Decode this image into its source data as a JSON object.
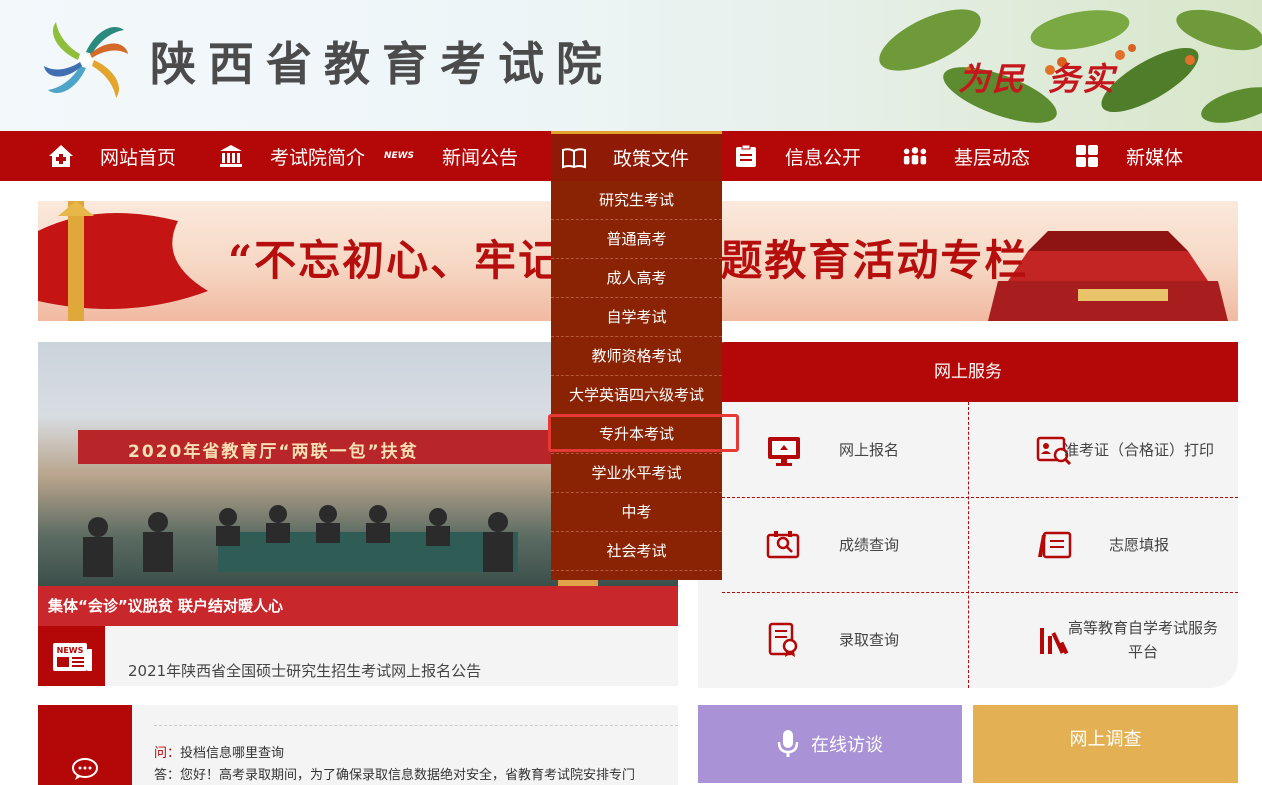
{
  "header": {
    "site_title": "陕西省教育考试院",
    "slogan_1": "为民",
    "slogan_2": "务实"
  },
  "nav": {
    "items": [
      {
        "label": "网站首页",
        "icon": "home-icon"
      },
      {
        "label": "考试院简介",
        "icon": "building-icon"
      },
      {
        "label": "新闻公告",
        "icon": "news-icon",
        "icon_text": "NEWS"
      },
      {
        "label": "政策文件",
        "icon": "book-icon",
        "active": true
      },
      {
        "label": "信息公开",
        "icon": "clipboard-icon"
      },
      {
        "label": "基层动态",
        "icon": "people-icon"
      },
      {
        "label": "新媒体",
        "icon": "grid-icon"
      }
    ]
  },
  "dropdown": {
    "items": [
      "研究生考试",
      "普通高考",
      "成人高考",
      "自学考试",
      "教师资格考试",
      "大学英语四六级考试",
      "专升本考试",
      "学业水平考试",
      "中考",
      "社会考试"
    ],
    "highlighted": "专升本考试"
  },
  "banner": {
    "text": "“不忘初心、牢记使命”主题教育活动专栏"
  },
  "featured": {
    "photo_banner_text": "2020年省教育厅“两联一包”扶贫",
    "caption": "集体“会诊”议脱贫 联户结对暖人心"
  },
  "news": {
    "icon_text": "NEWS",
    "headline": "2021年陕西省全国硕士研究生招生考试网上报名公告"
  },
  "qa": {
    "q_label": "问：",
    "question": "投档信息哪里查询",
    "a_label": "答：",
    "answer": "您好！高考录取期间，为了确保录取信息数据绝对安全，省教育考试院安排专门"
  },
  "services": {
    "title": "网上服务",
    "items": [
      {
        "label": "网上报名",
        "icon": "monitor-icon"
      },
      {
        "label": "准考证（合格证）打印",
        "icon": "id-card-search-icon"
      },
      {
        "label": "成绩查询",
        "icon": "score-search-icon"
      },
      {
        "label": "志愿填报",
        "icon": "pen-form-icon"
      },
      {
        "label": "录取查询",
        "icon": "certificate-icon"
      },
      {
        "label": "高等教育自学考试服务平台",
        "icon": "bar-chart-icon"
      }
    ]
  },
  "buttons": {
    "online_interview": "在线访谈",
    "survey": "网上调查"
  },
  "colors": {
    "primary_red": "#b40707",
    "dropdown_brown": "#8a2304",
    "highlight_red": "#e53935",
    "purple": "#a993d6",
    "gold": "#e3b154"
  }
}
